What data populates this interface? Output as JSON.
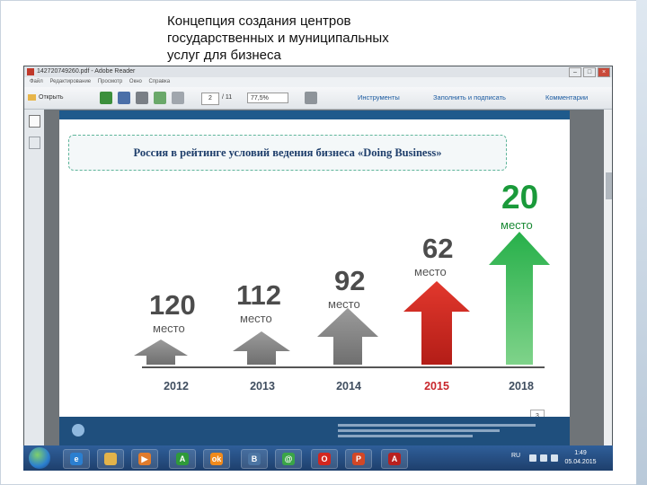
{
  "slide": {
    "title_lines": [
      "Концепция создания центров",
      "государственных и муниципальных",
      "услуг для бизнеса"
    ]
  },
  "reader": {
    "window_title": "142720749260.pdf - Adobe Reader",
    "menu": [
      "Файл",
      "Редактирование",
      "Просмотр",
      "Окно",
      "Справка"
    ],
    "toolbar": {
      "open_label": "Открыть",
      "page_current": "2",
      "page_total": "/ 11",
      "zoom": "77,5%",
      "tools_label": "Инструменты",
      "fill_sign_label": "Заполнить и подписать",
      "comments_label": "Комментарии"
    }
  },
  "document": {
    "headline": "Россия в рейтинге условий ведения бизнеса «Doing Business»",
    "rank_unit": "место",
    "page_number": "3",
    "colors": {
      "gray_arrow": "#8a8a8a",
      "red_arrow": "#d7281e",
      "green_arrow": "#1f9a3a",
      "rank_red": "#c8262c",
      "rank_green": "#1a9a3a"
    },
    "ranks": [
      {
        "year": "2012",
        "rank": "120",
        "highlight": "gray"
      },
      {
        "year": "2013",
        "rank": "112",
        "highlight": "gray"
      },
      {
        "year": "2014",
        "rank": "92",
        "highlight": "gray"
      },
      {
        "year": "2015",
        "rank": "62",
        "highlight": "red"
      },
      {
        "year": "2018",
        "rank": "20",
        "highlight": "green"
      }
    ]
  },
  "taskbar": {
    "icons": [
      "windows-start-icon",
      "internet-explorer-icon",
      "file-explorer-icon",
      "media-player-icon",
      "a-app-icon",
      "odnoklassniki-icon",
      "vkontakte-icon",
      "mail-at-icon",
      "opera-icon",
      "powerpoint-icon",
      "adobe-reader-icon"
    ],
    "language": "RU",
    "time": "1:49",
    "date": "05.04.2015"
  }
}
